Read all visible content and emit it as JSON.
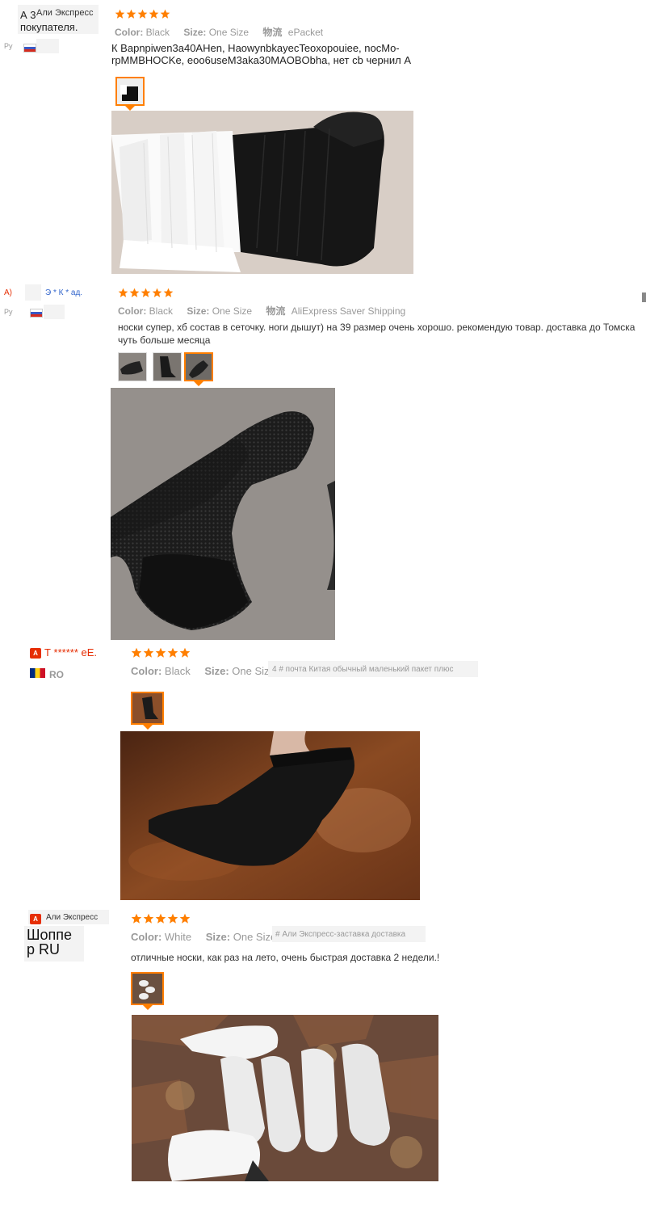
{
  "reviews": [
    {
      "store_badge": "Али Экспресс",
      "name_line1": "А 3 покупателя.",
      "country": "Ру",
      "color_label": "Color:",
      "color_value": "Black",
      "size_label": "Size:",
      "size_value": "One Size",
      "shipping_label": "物流",
      "shipping_value": "ePacket",
      "text": "К Bapnpiwen3a40AHen, HaowynbkayecTeoxopouiee, nocMo-rpMMBHOCKe, eoo6useM3aka30MAOBObha, нет cb чернил А",
      "rating": 5
    },
    {
      "prefix": "А)",
      "name": "Э * К * ад.",
      "country": "Ру",
      "color_label": "Color:",
      "color_value": "Black",
      "size_label": "Size:",
      "size_value": "One Size",
      "shipping_label": "物流",
      "shipping_value": "AliExpress Saver Shipping",
      "text": "носки супер, хб состав в сеточку. ноги дышут) на 39 размер очень хорошо. рекомендую товар. доставка до Томска чуть больше месяца",
      "rating": 5
    },
    {
      "badge": "А",
      "name": "Т ****** еЕ.",
      "country": "RO",
      "color_label": "Color:",
      "color_value": "Black",
      "size_label": "Size:",
      "size_value": "One Size",
      "shipping_text": "4 # почта Китая обычный маленький пакет плюс",
      "rating": 5
    },
    {
      "badge": "А",
      "store_badge": "Али Экспресс",
      "name_line1": "Шоппе",
      "name_line2": "р RU",
      "color_label": "Color:",
      "color_value": "White",
      "size_label": "Size:",
      "size_value": "One Size",
      "shipping_text": "# Али Экспресс-заставка доставка",
      "text": "отличные носки, как раз на лето, очень быстрая доставка 2 недели.!",
      "rating": 5
    }
  ],
  "colors": {
    "star": "#ff7f00",
    "accent": "#ff7f00",
    "badge_red": "#e62e04",
    "link_blue": "#3366cc",
    "name_red": "#e62e04"
  }
}
